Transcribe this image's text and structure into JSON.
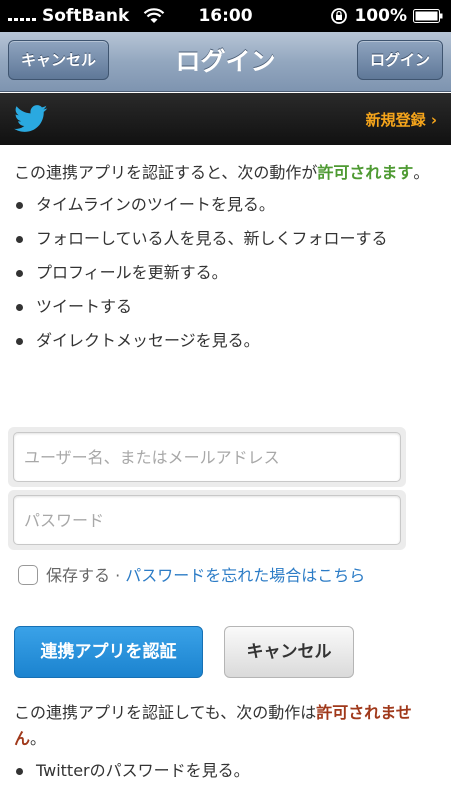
{
  "statusbar": {
    "carrier": "SoftBank",
    "time": "16:00",
    "battery": "100%"
  },
  "navbar": {
    "title": "ログイン",
    "left_button": "キャンセル",
    "right_button": "ログイン"
  },
  "twitter_bar": {
    "signup_label": "新規登録 ›",
    "brand_color": "#1da1f2"
  },
  "allowed": {
    "intro_prefix": "この連携アプリを認証すると、次の動作が",
    "intro_emphasis": "許可されます",
    "intro_suffix": "。",
    "items": [
      "タイムラインのツイートを見る。",
      "フォローしている人を見る、新しくフォローする",
      "プロフィールを更新する。",
      "ツイートする",
      "ダイレクトメッセージを見る。"
    ]
  },
  "form": {
    "username_placeholder": "ユーザー名、またはメールアドレス",
    "password_placeholder": "パスワード",
    "remember_label": "保存する",
    "separator": " · ",
    "forgot_link": "パスワードを忘れた場合はこちら"
  },
  "buttons": {
    "authorize": "連携アプリを認証",
    "cancel": "キャンセル"
  },
  "denied": {
    "intro_prefix": "この連携アプリを認証しても、次の動作は",
    "intro_emphasis": "許可されません",
    "intro_suffix": "。",
    "items": [
      "Twitterのパスワードを見る。"
    ]
  }
}
